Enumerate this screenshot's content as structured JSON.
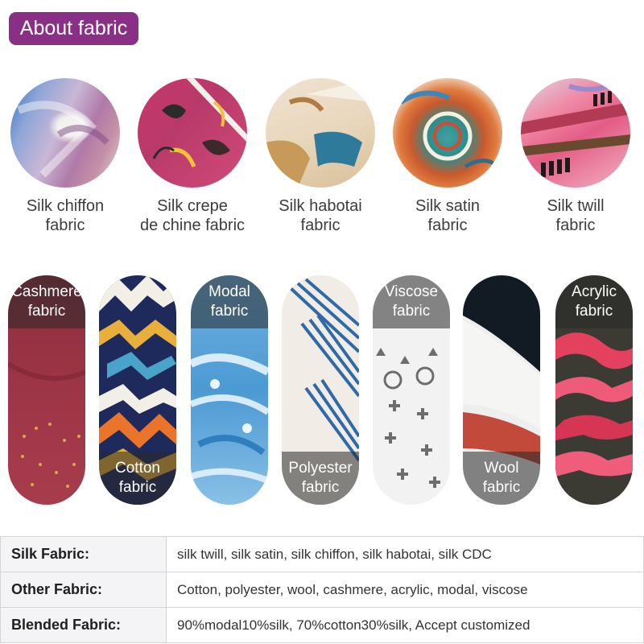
{
  "header": {
    "title": "About fabric"
  },
  "silk_fabrics": [
    {
      "line1": "Silk chiffon",
      "line2": "fabric",
      "icon": "silk-chiffon-swatch"
    },
    {
      "line1": "Silk crepe",
      "line2": "de chine fabric",
      "icon": "silk-crepe-swatch"
    },
    {
      "line1": "Silk habotai",
      "line2": "fabric",
      "icon": "silk-habotai-swatch"
    },
    {
      "line1": "Silk satin",
      "line2": "fabric",
      "icon": "silk-satin-swatch"
    },
    {
      "line1": "Silk twill",
      "line2": "fabric",
      "icon": "silk-twill-swatch"
    }
  ],
  "other_fabrics": [
    {
      "line1": "Cashmere",
      "line2": "fabric",
      "label_pos": "top",
      "icon": "cashmere-swatch"
    },
    {
      "line1": "Cotton",
      "line2": "fabric",
      "label_pos": "bottom",
      "icon": "cotton-swatch"
    },
    {
      "line1": "Modal",
      "line2": "fabric",
      "label_pos": "top",
      "icon": "modal-swatch"
    },
    {
      "line1": "Polyester",
      "line2": "fabric",
      "label_pos": "bottom",
      "icon": "polyester-swatch"
    },
    {
      "line1": "Viscose",
      "line2": "fabric",
      "label_pos": "top",
      "icon": "viscose-swatch"
    },
    {
      "line1": "Wool",
      "line2": "fabric",
      "label_pos": "bottom",
      "icon": "wool-swatch"
    },
    {
      "line1": "Acrylic",
      "line2": "fabric",
      "label_pos": "top",
      "icon": "acrylic-swatch"
    }
  ],
  "table": {
    "rows": [
      {
        "key": "Silk Fabric:",
        "value": "silk twill, silk satin, silk chiffon, silk habotai, silk CDC"
      },
      {
        "key": "Other Fabric:",
        "value": "Cotton, polyester, wool, cashmere, acrylic, modal, viscose"
      },
      {
        "key": "Blended Fabric:",
        "value": "90%modal10%silk, 70%cotton30%silk, Accept customized"
      }
    ]
  },
  "colors": {
    "accent": "#8a2f86",
    "table_key_bg": "#f4f4f6",
    "border": "#d4d4d4"
  }
}
